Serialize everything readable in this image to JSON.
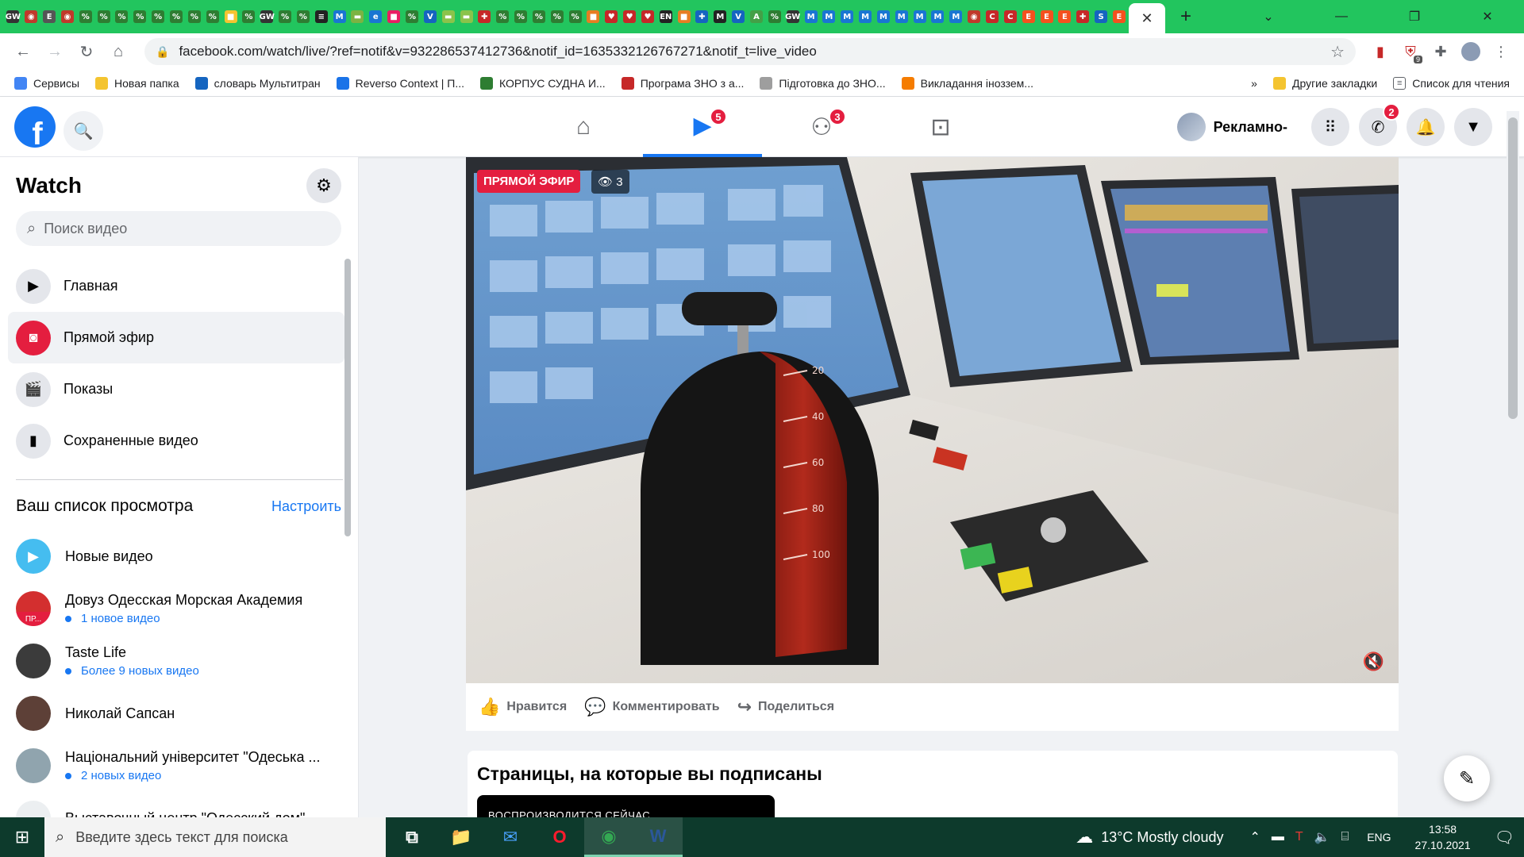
{
  "browser": {
    "url": "facebook.com/watch/live/?ref=notif&v=932286537412736&notif_id=1635332126767271&notif_t=live_video",
    "tab_close": "✕",
    "new_tab": "+",
    "mini_tabs": [
      {
        "letter": "GW",
        "color": "#333"
      },
      {
        "letter": "◉",
        "color": "#c0392b"
      },
      {
        "letter": "E",
        "color": "#555"
      },
      {
        "letter": "◉",
        "color": "#c0392b"
      },
      {
        "letter": "%",
        "color": "#2e7d32"
      },
      {
        "letter": "%",
        "color": "#2e7d32"
      },
      {
        "letter": "%",
        "color": "#2e7d32"
      },
      {
        "letter": "%",
        "color": "#2e7d32"
      },
      {
        "letter": "%",
        "color": "#2e7d32"
      },
      {
        "letter": "%",
        "color": "#2e7d32"
      },
      {
        "letter": "%",
        "color": "#2e7d32"
      },
      {
        "letter": "%",
        "color": "#2e7d32"
      },
      {
        "letter": "■",
        "color": "#f4c430"
      },
      {
        "letter": "%",
        "color": "#2e7d32"
      },
      {
        "letter": "GW",
        "color": "#333"
      },
      {
        "letter": "%",
        "color": "#2e7d32"
      },
      {
        "letter": "%",
        "color": "#2e7d32"
      },
      {
        "letter": "≡",
        "color": "#222"
      },
      {
        "letter": "M",
        "color": "#1976d2"
      },
      {
        "letter": "▬",
        "color": "#7cb342"
      },
      {
        "letter": "e",
        "color": "#1976d2"
      },
      {
        "letter": "■",
        "color": "#e91e63"
      },
      {
        "letter": "%",
        "color": "#2e7d32"
      },
      {
        "letter": "V",
        "color": "#1565c0"
      },
      {
        "letter": "▬",
        "color": "#8bc34a"
      },
      {
        "letter": "▬",
        "color": "#8bc34a"
      },
      {
        "letter": "✚",
        "color": "#c62828"
      },
      {
        "letter": "%",
        "color": "#2e7d32"
      },
      {
        "letter": "%",
        "color": "#2e7d32"
      },
      {
        "letter": "%",
        "color": "#2e7d32"
      },
      {
        "letter": "%",
        "color": "#2e7d32"
      },
      {
        "letter": "%",
        "color": "#2e7d32"
      },
      {
        "letter": "■",
        "color": "#e67e22"
      },
      {
        "letter": "♥",
        "color": "#c62828"
      },
      {
        "letter": "♥",
        "color": "#c62828"
      },
      {
        "letter": "♥",
        "color": "#c62828"
      },
      {
        "letter": "EN",
        "color": "#222"
      },
      {
        "letter": "■",
        "color": "#e67e22"
      },
      {
        "letter": "✚",
        "color": "#1565c0"
      },
      {
        "letter": "M",
        "color": "#222"
      },
      {
        "letter": "V",
        "color": "#1565c0"
      },
      {
        "letter": "A",
        "color": "#43a047"
      },
      {
        "letter": "%",
        "color": "#2e7d32"
      },
      {
        "letter": "GW",
        "color": "#333"
      },
      {
        "letter": "M",
        "color": "#1976d2"
      },
      {
        "letter": "M",
        "color": "#1976d2"
      },
      {
        "letter": "M",
        "color": "#1976d2"
      },
      {
        "letter": "M",
        "color": "#1976d2"
      },
      {
        "letter": "M",
        "color": "#1976d2"
      },
      {
        "letter": "M",
        "color": "#1976d2"
      },
      {
        "letter": "M",
        "color": "#1976d2"
      },
      {
        "letter": "M",
        "color": "#1976d2"
      },
      {
        "letter": "M",
        "color": "#1976d2"
      },
      {
        "letter": "◉",
        "color": "#c0392b"
      },
      {
        "letter": "C",
        "color": "#c62828"
      },
      {
        "letter": "C",
        "color": "#c62828"
      },
      {
        "letter": "E",
        "color": "#f4511e"
      },
      {
        "letter": "E",
        "color": "#f4511e"
      },
      {
        "letter": "E",
        "color": "#f4511e"
      },
      {
        "letter": "✚",
        "color": "#c62828"
      },
      {
        "letter": "S",
        "color": "#1565c0"
      },
      {
        "letter": "E",
        "color": "#f4511e"
      }
    ],
    "window_controls": {
      "minimize": "—",
      "maximize": "❐",
      "close": "✕",
      "chevron": "⌄"
    }
  },
  "bookmarks": [
    {
      "label": "Сервисы",
      "icon": "apps-grid",
      "color": "#4285f4"
    },
    {
      "label": "Новая папка",
      "icon": "folder",
      "color": "#f4c430"
    },
    {
      "label": "словарь Мультитран",
      "icon": "multitran",
      "color": "#1565c0"
    },
    {
      "label": "Reverso Context | П...",
      "icon": "reverso",
      "color": "#1a73e8"
    },
    {
      "label": "КОРПУС СУДНА И...",
      "icon": "tree",
      "color": "#2e7d32"
    },
    {
      "label": "Програма ЗНО з а...",
      "icon": "envelope",
      "color": "#c62828"
    },
    {
      "label": "Підготовка до ЗНО...",
      "icon": "book",
      "color": "#9e9e9e"
    },
    {
      "label": "Викладання іноззем...",
      "icon": "blogger",
      "color": "#f57c00"
    }
  ],
  "bookmarks_right": {
    "more": "»",
    "other": "Другие закладки",
    "reading_list": "Список для чтения"
  },
  "fb": {
    "logo": "f",
    "tabs": [
      {
        "name": "home",
        "icon": "⌂",
        "badge": ""
      },
      {
        "name": "watch",
        "icon": "▶",
        "badge": "5"
      },
      {
        "name": "groups",
        "icon": "⚇",
        "badge": "3"
      },
      {
        "name": "gaming",
        "icon": "⊡",
        "badge": ""
      }
    ],
    "profile_name": "Рекламно-",
    "messenger_badge": "2"
  },
  "sidebar": {
    "title": "Watch",
    "search_placeholder": "Поиск видео",
    "menu": [
      {
        "label": "Главная",
        "icon": "▶",
        "active": false
      },
      {
        "label": "Прямой эфир",
        "icon": "◙",
        "active": true
      },
      {
        "label": "Показы",
        "icon": "🎬",
        "active": false
      },
      {
        "label": "Сохраненные видео",
        "icon": "▮",
        "active": false
      }
    ],
    "watchlist_title": "Ваш список просмотра",
    "watchlist_manage": "Настроить",
    "watchlist": [
      {
        "name": "Новые видео",
        "sub": "",
        "thumb": "#45bdf0"
      },
      {
        "name": "Довуз Одесская Морская Академия",
        "sub": "1 новое видео",
        "thumb": "#d32f2f",
        "live": "ПР..."
      },
      {
        "name": "Taste Life",
        "sub": "Более 9 новых видео",
        "thumb": "#3b3b3b"
      },
      {
        "name": "Николай Сапсан",
        "sub": "",
        "thumb": "#5d4037"
      },
      {
        "name": "Національний університет \"Одеська ...",
        "sub": "2 новых видео",
        "thumb": "#90a4ae"
      },
      {
        "name": "Выставочный центр \"Одесский дом\"",
        "sub": "",
        "thumb": "#eceff1"
      }
    ]
  },
  "video": {
    "live_label": "ПРЯМОЙ ЭФИР",
    "viewers": "3",
    "dial_marks": [
      "20",
      "40",
      "60",
      "80",
      "100"
    ],
    "actions": [
      {
        "label": "Нравится",
        "icon": "👍"
      },
      {
        "label": "Комментировать",
        "icon": "💬"
      },
      {
        "label": "Поделиться",
        "icon": "↪"
      }
    ]
  },
  "pages": {
    "title": "Страницы, на которые вы подписаны",
    "now_playing": "ВОСПРОИЗВОДИТСЯ СЕЙЧАС"
  },
  "taskbar": {
    "search_placeholder": "Введите здесь текст для поиска",
    "weather": "13°C  Mostly cloudy",
    "lang": "ENG",
    "time": "13:58",
    "date": "27.10.2021",
    "apps": [
      {
        "name": "task-view",
        "icon": "⧉",
        "running": false
      },
      {
        "name": "explorer",
        "icon": "📁",
        "running": false
      },
      {
        "name": "mail",
        "icon": "✉",
        "running": false
      },
      {
        "name": "opera",
        "icon": "O",
        "running": false
      },
      {
        "name": "chrome",
        "icon": "◉",
        "running": true
      },
      {
        "name": "word",
        "icon": "W",
        "running": true
      }
    ]
  }
}
